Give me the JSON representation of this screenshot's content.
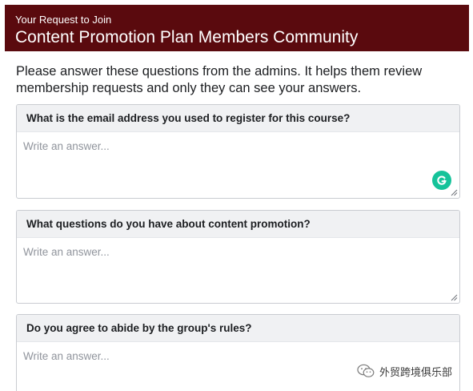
{
  "header": {
    "subtitle": "Your Request to Join",
    "title": "Content Promotion Plan Members Community"
  },
  "intro_text": "Please answer these questions from the admins. It helps them review membership requests and only they can see your answers.",
  "questions": [
    {
      "label": "What is the email address you used to register for this course?",
      "placeholder": "Write an answer...",
      "value": ""
    },
    {
      "label": "What questions do you have about content promotion?",
      "placeholder": "Write an answer...",
      "value": ""
    },
    {
      "label": "Do you agree to abide by the group's rules?",
      "placeholder": "Write an answer...",
      "value": ""
    }
  ],
  "icons": {
    "grammarly": "grammarly-icon",
    "resize": "resize-handle-icon",
    "wechat": "wechat-icon"
  },
  "colors": {
    "header_bg": "#5a0a0e",
    "grammarly": "#15c39a"
  },
  "watermark": {
    "text": "外贸跨境俱乐部"
  }
}
